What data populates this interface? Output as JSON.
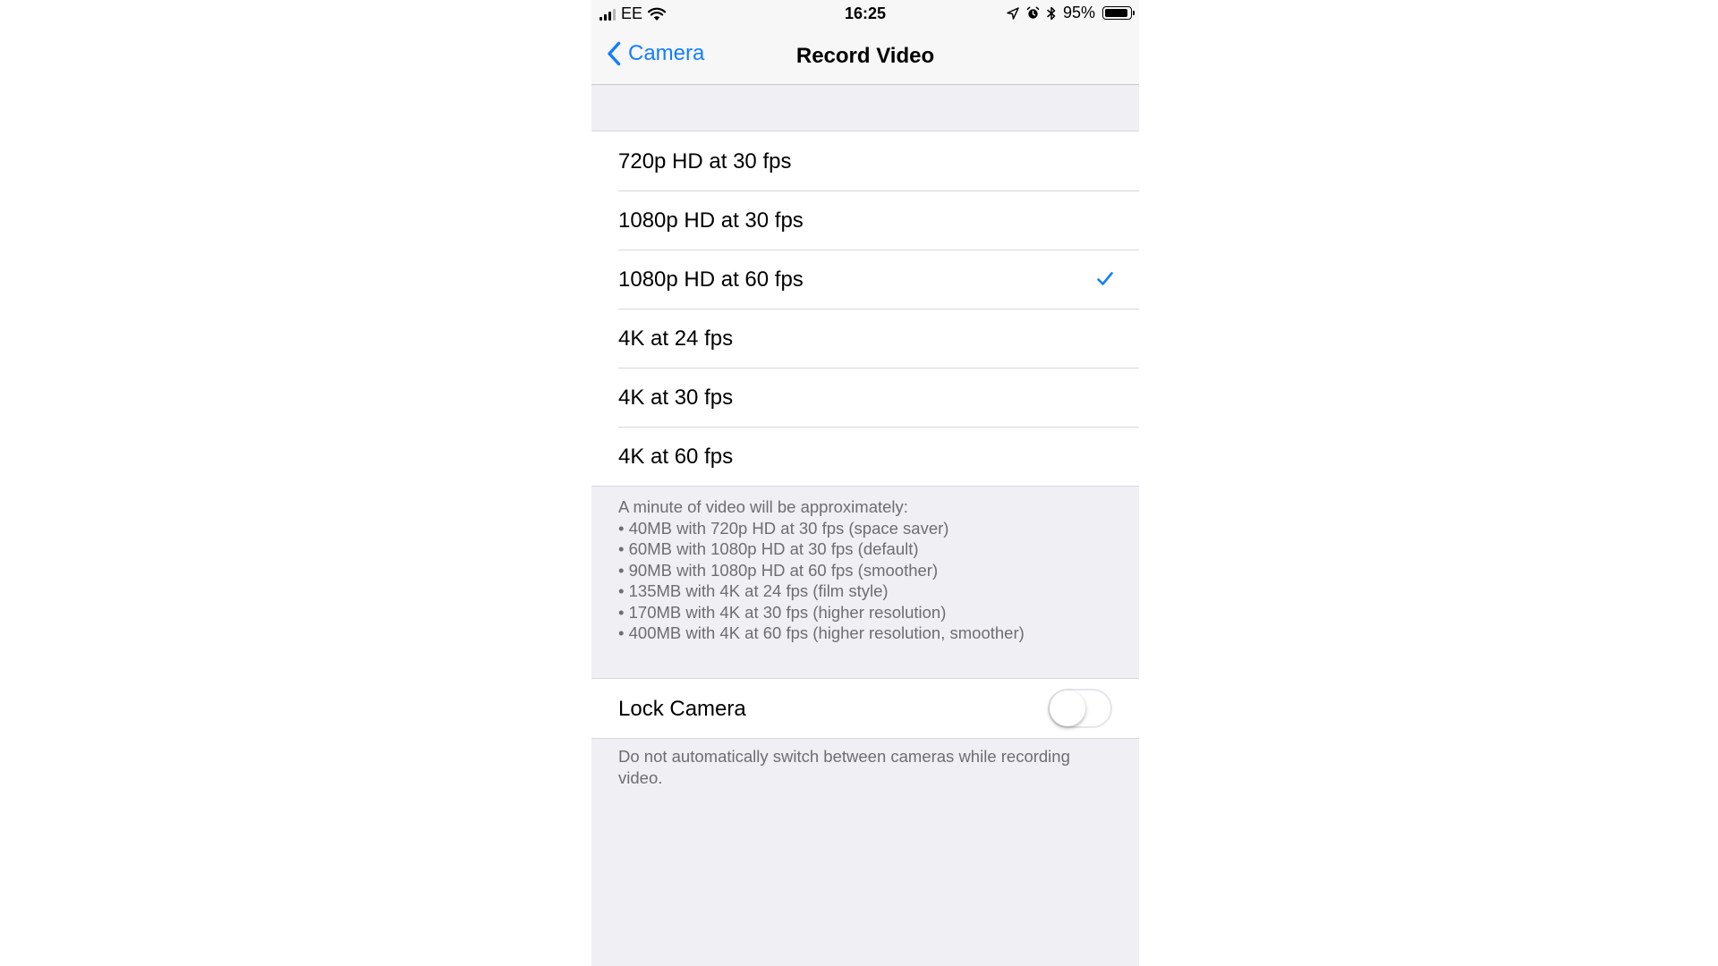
{
  "status_bar": {
    "carrier": "EE",
    "time": "16:25",
    "battery_text": "95%",
    "battery_level": 0.95
  },
  "nav": {
    "back_label": "Camera",
    "title": "Record Video"
  },
  "options": [
    {
      "label": "720p HD at 30 fps",
      "selected": false
    },
    {
      "label": "1080p HD at 30 fps",
      "selected": false
    },
    {
      "label": "1080p HD at 60 fps",
      "selected": true
    },
    {
      "label": "4K at 24 fps",
      "selected": false
    },
    {
      "label": "4K at 30 fps",
      "selected": false
    },
    {
      "label": "4K at 60 fps",
      "selected": false
    }
  ],
  "size_note": {
    "heading": "A minute of video will be approximately:",
    "lines": [
      "• 40MB with 720p HD at 30 fps (space saver)",
      "• 60MB with 1080p HD at 30 fps (default)",
      "• 90MB with 1080p HD at 60 fps (smoother)",
      "• 135MB with 4K at 24 fps (film style)",
      "• 170MB with 4K at 30 fps (higher resolution)",
      "• 400MB with 4K at 60 fps (higher resolution, smoother)"
    ]
  },
  "lock_camera": {
    "label": "Lock Camera",
    "enabled": false,
    "note": "Do not automatically switch between cameras while recording video."
  },
  "colors": {
    "accent": "#147efb",
    "background": "#efeff4",
    "note_text": "#6d6d72"
  },
  "icons": {
    "back": "chevron-left-icon",
    "check": "checkmark-icon",
    "wifi": "wifi-icon",
    "location": "location-arrow-icon",
    "alarm": "alarm-icon",
    "bluetooth": "bluetooth-icon",
    "battery": "battery-icon",
    "signal": "signal-bars-icon"
  }
}
